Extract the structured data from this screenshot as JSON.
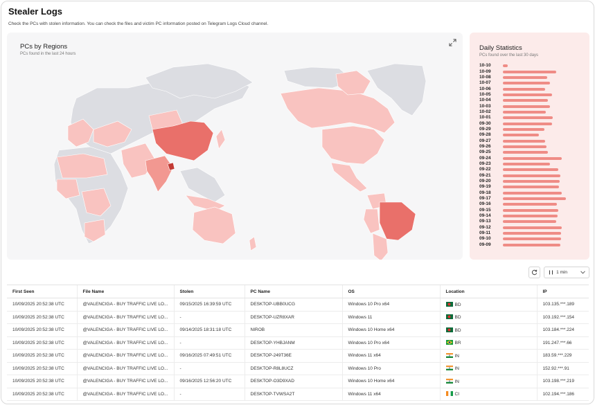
{
  "page": {
    "title": "Stealer Logs",
    "subtitle": "Check the PCs with stolen information. You can check the files and victim PC information posted on Telegram Logs Cloud channel."
  },
  "map_panel": {
    "title": "PCs by Regions",
    "subtitle": "PCs found in the last 24 hours",
    "expand_icon": "expand-icon",
    "highlighted_regions": [
      "China",
      "Bangladesh",
      "Brazil",
      "India",
      "Canada",
      "United States",
      "Australia",
      "Argentina",
      "Russia",
      "Greenland"
    ],
    "colors": {
      "base": "#dcdde2",
      "light": "#f9c3c0",
      "medium": "#f29891",
      "strong": "#e9706a",
      "darkest": "#c23b35"
    }
  },
  "stats_panel": {
    "title": "Daily Statistics",
    "subtitle": "PCs found over the last 30 days",
    "bar_color": "#ef8c86",
    "days": [
      {
        "date": "10-10",
        "value": 0.08
      },
      {
        "date": "10-09",
        "value": 0.9
      },
      {
        "date": "10-08",
        "value": 0.75
      },
      {
        "date": "10-07",
        "value": 0.8
      },
      {
        "date": "10-06",
        "value": 0.72
      },
      {
        "date": "10-05",
        "value": 0.84
      },
      {
        "date": "10-04",
        "value": 0.76
      },
      {
        "date": "10-03",
        "value": 0.8
      },
      {
        "date": "10-02",
        "value": 0.73
      },
      {
        "date": "10-01",
        "value": 0.85
      },
      {
        "date": "09-30",
        "value": 0.83
      },
      {
        "date": "09-29",
        "value": 0.71
      },
      {
        "date": "09-28",
        "value": 0.61
      },
      {
        "date": "09-27",
        "value": 0.72
      },
      {
        "date": "09-26",
        "value": 0.74
      },
      {
        "date": "09-25",
        "value": 0.77
      },
      {
        "date": "09-24",
        "value": 1.0
      },
      {
        "date": "09-23",
        "value": 0.8
      },
      {
        "date": "09-22",
        "value": 0.94
      },
      {
        "date": "09-21",
        "value": 0.98
      },
      {
        "date": "09-20",
        "value": 0.97
      },
      {
        "date": "09-19",
        "value": 0.95
      },
      {
        "date": "09-18",
        "value": 1.0
      },
      {
        "date": "09-17",
        "value": 1.07
      },
      {
        "date": "09-16",
        "value": 0.92
      },
      {
        "date": "09-15",
        "value": 0.94
      },
      {
        "date": "09-14",
        "value": 0.93
      },
      {
        "date": "09-13",
        "value": 0.91
      },
      {
        "date": "09-12",
        "value": 1.0
      },
      {
        "date": "09-11",
        "value": 0.99
      },
      {
        "date": "09-10",
        "value": 0.99
      },
      {
        "date": "09-09",
        "value": 0.98
      }
    ]
  },
  "controls": {
    "refresh_icon": "refresh-icon",
    "interval_label": "1 min",
    "interval_pause_icon": "pause-icon",
    "interval_chevron_icon": "chevron-down-icon"
  },
  "table": {
    "columns": [
      "First Seen",
      "File Name",
      "Stolen",
      "PC Name",
      "OS",
      "Location",
      "IP"
    ],
    "rows": [
      {
        "first_seen": "10/09/2025 20:52:38 UTC",
        "file_name": "@VALENCIGA - BUY TRAFFIC LIVE LO...",
        "stolen": "09/15/2025 16:39:59 UTC",
        "pc_name": "DESKTOP-UBB0UCG",
        "os": "Windows 10 Pro x64",
        "flag": "bd",
        "location": "BD",
        "ip": "103.135.***.189"
      },
      {
        "first_seen": "10/09/2025 20:52:38 UTC",
        "file_name": "@VALENCIGA - BUY TRAFFIC LIVE LO...",
        "stolen": "-",
        "pc_name": "DESKTOP-UZR8XAR",
        "os": "Windows 11",
        "flag": "bd",
        "location": "BD",
        "ip": "103.192.***.154"
      },
      {
        "first_seen": "10/09/2025 20:52:38 UTC",
        "file_name": "@VALENCIGA - BUY TRAFFIC LIVE LO...",
        "stolen": "09/14/2025 18:31:18 UTC",
        "pc_name": "NIROB",
        "os": "Windows 10 Home x64",
        "flag": "bd",
        "location": "BD",
        "ip": "103.184.***.224"
      },
      {
        "first_seen": "10/09/2025 20:52:38 UTC",
        "file_name": "@VALENCIGA - BUY TRAFFIC LIVE LO...",
        "stolen": "-",
        "pc_name": "DESKTOP-YHBJANM",
        "os": "Windows 10 Pro x64",
        "flag": "br",
        "location": "BR",
        "ip": "191.247.***.66"
      },
      {
        "first_seen": "10/09/2025 20:52:38 UTC",
        "file_name": "@VALENCIGA - BUY TRAFFIC LIVE LO...",
        "stolen": "09/16/2025 07:49:51 UTC",
        "pc_name": "DESKTOP-249T36E",
        "os": "Windows 11 x64",
        "flag": "in",
        "location": "IN",
        "ip": "183.59.***.229"
      },
      {
        "first_seen": "10/09/2025 20:52:38 UTC",
        "file_name": "@VALENCIGA - BUY TRAFFIC LIVE LO...",
        "stolen": "-",
        "pc_name": "DESKTOP-R8L8UCZ",
        "os": "Windows 10 Pro",
        "flag": "in",
        "location": "IN",
        "ip": "152.92.***.91"
      },
      {
        "first_seen": "10/09/2025 20:52:38 UTC",
        "file_name": "@VALENCIGA - BUY TRAFFIC LIVE LO...",
        "stolen": "09/16/2025 12:56:20 UTC",
        "pc_name": "DESKTOP-O3D9XAD",
        "os": "Windows 10 Home x64",
        "flag": "in",
        "location": "IN",
        "ip": "103.198.***.219"
      },
      {
        "first_seen": "10/09/2025 20:52:38 UTC",
        "file_name": "@VALENCIGA - BUY TRAFFIC LIVE LO...",
        "stolen": "-",
        "pc_name": "DESKTOP-TVWSA2T",
        "os": "Windows 11 x64",
        "flag": "ci",
        "location": "CI",
        "ip": "102.194.***.186"
      }
    ]
  }
}
